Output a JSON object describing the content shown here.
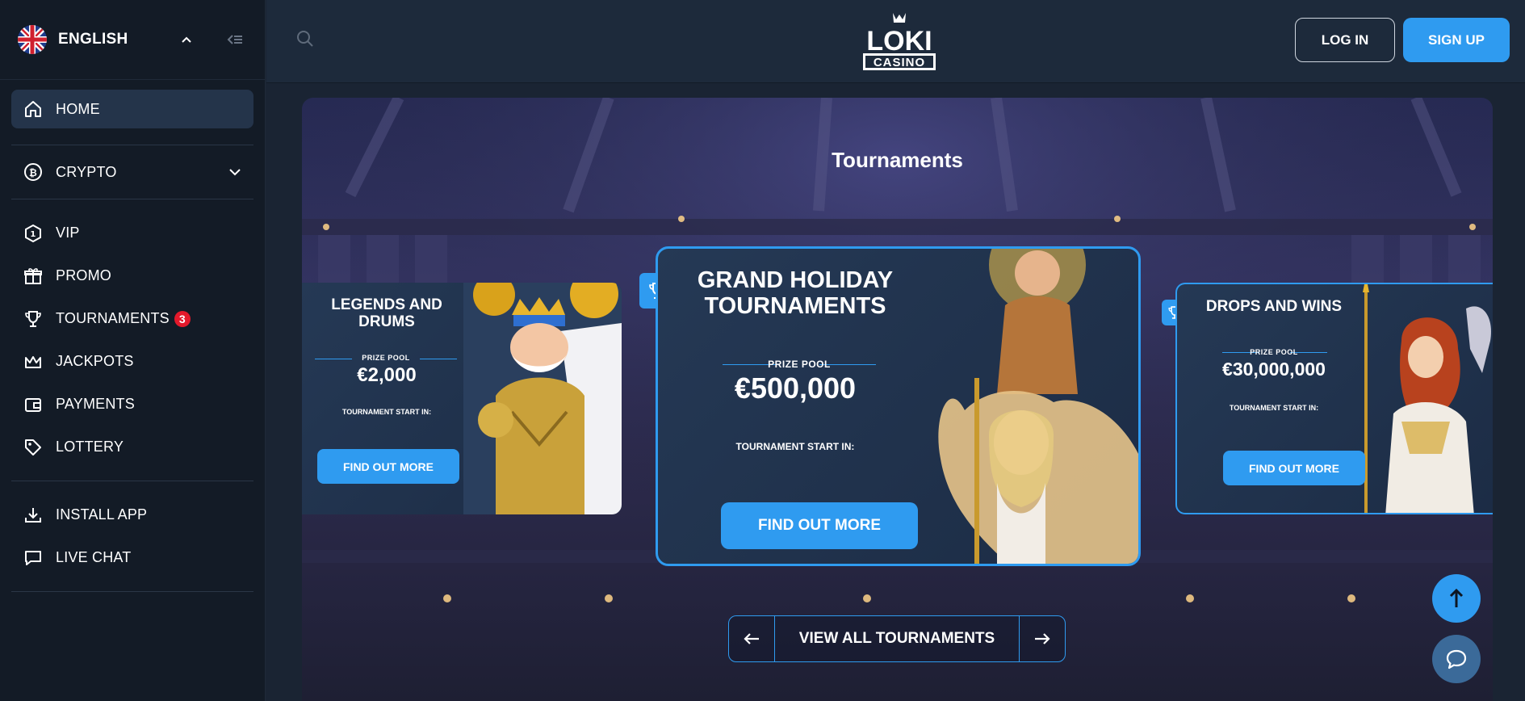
{
  "sidebar": {
    "language": "ENGLISH",
    "nav": [
      {
        "label": "HOME"
      },
      {
        "label": "CRYPTO"
      },
      {
        "label": "VIP"
      },
      {
        "label": "PROMO"
      },
      {
        "label": "TOURNAMENTS",
        "badge": "3"
      },
      {
        "label": "JACKPOTS"
      },
      {
        "label": "PAYMENTS"
      },
      {
        "label": "LOTTERY"
      },
      {
        "label": "INSTALL APP"
      },
      {
        "label": "LIVE CHAT"
      }
    ]
  },
  "header": {
    "logo_top": "LOKI",
    "logo_bottom": "CASINO",
    "login": "LOG IN",
    "signup": "SIGN UP"
  },
  "banner": {
    "title": "Tournaments",
    "cards": [
      {
        "name": "LEGENDS AND DRUMS",
        "pool_label": "PRIZE POOL",
        "pool_value": "€2,000",
        "start_label": "TOURNAMENT START IN:",
        "cta": "FIND OUT MORE"
      },
      {
        "name": "GRAND HOLIDAY TOURNAMENTS",
        "pool_label": "PRIZE POOL",
        "pool_value": "€500,000",
        "start_label": "TOURNAMENT START IN:",
        "cta": "FIND OUT MORE"
      },
      {
        "name": "DROPS AND WINS",
        "pool_label": "PRIZE POOL",
        "pool_value": "€30,000,000",
        "start_label": "TOURNAMENT START IN:",
        "cta": "FIND OUT MORE"
      }
    ],
    "view_all": "VIEW ALL TOURNAMENTS"
  },
  "colors": {
    "accent": "#2f9bf0",
    "sidebar_bg": "#131b26",
    "header_bg": "#1d2a3b",
    "badge": "#e3192b"
  }
}
